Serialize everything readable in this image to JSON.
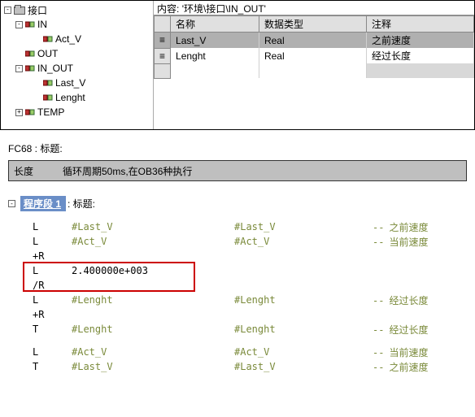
{
  "pathbar": {
    "label": "内容:",
    "value": "'环境\\接口\\IN_OUT'"
  },
  "grid": {
    "headers": {
      "name": "名称",
      "type": "数据类型",
      "comment": "注释"
    },
    "rows": [
      {
        "name": "Last_V",
        "type": "Real",
        "comment": "之前速度",
        "selected": true
      },
      {
        "name": "Lenght",
        "type": "Real",
        "comment": "经过长度",
        "selected": false
      }
    ],
    "row_marker": "≡"
  },
  "tree": {
    "root": "接口",
    "items": [
      {
        "label": "IN",
        "expanded": true,
        "children": [
          {
            "label": "Act_V"
          }
        ]
      },
      {
        "label": "OUT",
        "expanded": false,
        "children": []
      },
      {
        "label": "IN_OUT",
        "expanded": true,
        "children": [
          {
            "label": "Last_V"
          },
          {
            "label": "Lenght"
          }
        ]
      },
      {
        "label": "TEMP",
        "expanded": false,
        "children": []
      }
    ]
  },
  "fc": {
    "title": "FC68 : 标题:"
  },
  "desc": {
    "label": "长度",
    "text": "循环周期50ms,在OB36种执行"
  },
  "segment": {
    "label": "程序段 1",
    "suffix": ": 标题:"
  },
  "code": [
    {
      "op": "L",
      "arg": "#Last_V",
      "sym": "#Last_V",
      "com": "之前速度"
    },
    {
      "op": "L",
      "arg": "#Act_V",
      "sym": "#Act_V",
      "com": "当前速度"
    },
    {
      "op": "+R",
      "arg": "",
      "sym": "",
      "com": ""
    },
    {
      "op": "L",
      "arg": "2.400000e+003",
      "sym": "",
      "com": "",
      "black": true
    },
    {
      "op": "/R",
      "arg": "",
      "sym": "",
      "com": ""
    },
    {
      "op": "L",
      "arg": "#Lenght",
      "sym": "#Lenght",
      "com": "经过长度"
    },
    {
      "op": "+R",
      "arg": "",
      "sym": "",
      "com": ""
    },
    {
      "op": "T",
      "arg": "#Lenght",
      "sym": "#Lenght",
      "com": "经过长度"
    },
    {
      "spacer": true
    },
    {
      "op": "L",
      "arg": "#Act_V",
      "sym": "#Act_V",
      "com": "当前速度"
    },
    {
      "op": "T",
      "arg": "#Last_V",
      "sym": "#Last_V",
      "com": "之前速度"
    }
  ],
  "dashes": "--"
}
